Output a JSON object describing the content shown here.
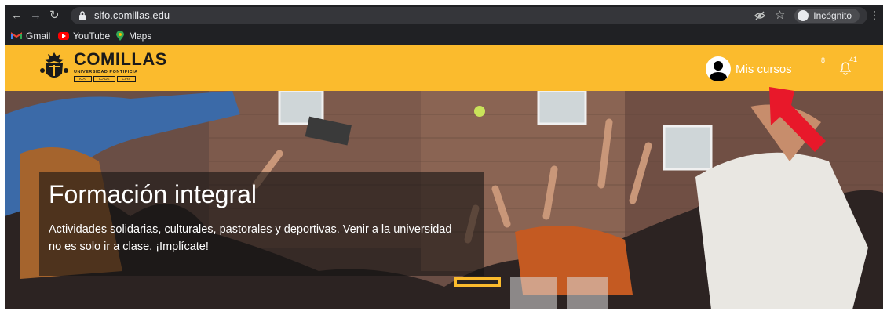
{
  "browser": {
    "url": "sifo.comillas.edu",
    "incognito_label": "Incógnito",
    "icons": [
      "back-arrow-icon",
      "forward-arrow-icon",
      "reload-icon",
      "lock-icon",
      "eye-off-icon",
      "star-icon",
      "incognito-icon",
      "kebab-menu-icon"
    ]
  },
  "bookmarks": [
    {
      "label": "Gmail",
      "icon": "gmail-icon"
    },
    {
      "label": "YouTube",
      "icon": "youtube-icon"
    },
    {
      "label": "Maps",
      "icon": "maps-icon"
    }
  ],
  "header": {
    "logo_text": "COMILLAS",
    "logo_subtitle": "UNIVERSIDAD PONTIFICIA",
    "logo_sections": [
      "ICAI",
      "ICADE",
      "CIHS"
    ],
    "account_label": "Mis cursos",
    "notification_left": "8",
    "notification_count": "41",
    "colors": {
      "brand": "#fbbb2d",
      "text": "#ffffff"
    }
  },
  "hero": {
    "title": "Formación integral",
    "text": "Actividades solidarias, culturales, pastorales y deportivas. Venir a la universidad no es solo ir a clase. ¡Implícate!"
  },
  "carousel": {
    "slides": 3,
    "active_index": 0,
    "colors": {
      "active": "#fbbb2d"
    }
  },
  "annotation": {
    "arrow_color": "#e8182a"
  }
}
